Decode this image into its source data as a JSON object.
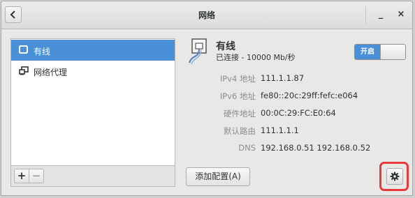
{
  "window": {
    "title": "网络",
    "back_icon": "chevron-left-icon",
    "minimize_label": "_",
    "close_label": "×"
  },
  "sidebar": {
    "items": [
      {
        "label": "有线",
        "icon": "wired-network-icon",
        "selected": true
      },
      {
        "label": "网络代理",
        "icon": "network-proxy-icon",
        "selected": false
      }
    ],
    "add_label": "+",
    "remove_label": "−"
  },
  "connection": {
    "icon": "ethernet-connection-icon",
    "name": "有线",
    "status": "已连接 - 10000 Mb/秒",
    "switch_label": "开启",
    "switch_on": true
  },
  "details": [
    {
      "label": "IPv4 地址",
      "value": "111.1.1.87"
    },
    {
      "label": "IPv6 地址",
      "value": "fe80::20c:29ff:fefc:e064"
    },
    {
      "label": "硬件地址",
      "value": "00:0C:29:FC:E0:64"
    },
    {
      "label": "默认路由",
      "value": "111.1.1.1"
    },
    {
      "label": "DNS",
      "value": "192.168.0.51 192.168.0.52"
    }
  ],
  "footer": {
    "add_profile_label": "添加配置(A)",
    "settings_icon": "gear-icon"
  },
  "colors": {
    "accent": "#4a90d9",
    "highlight": "#e83a3a"
  }
}
